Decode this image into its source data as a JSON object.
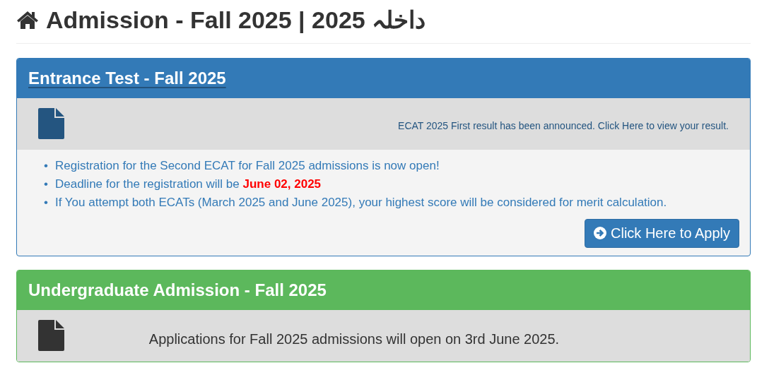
{
  "page": {
    "title": "Admission - Fall 2025 | 2025 داخلہ"
  },
  "panels": [
    {
      "kind": "primary",
      "heading": "Entrance Test - Fall 2025",
      "heading_link": true,
      "notice": "ECAT 2025 First result has been announced. Click Here to view your result.",
      "bullets": [
        {
          "marker": "•",
          "text": "Registration for the Second ECAT for Fall 2025 admissions is now open!"
        },
        {
          "marker": "•",
          "text": "Deadline for the registration will be",
          "highlight": "June 02, 2025"
        },
        {
          "marker": "•",
          "text": "If You attempt both ECATs (March 2025 and June 2025), your highest score will be considered for merit calculation."
        }
      ],
      "button": "Click Here to Apply"
    },
    {
      "kind": "success",
      "heading": "Undergraduate Admission - Fall 2025",
      "heading_link": false,
      "notice": "Applications for Fall 2025 admissions will open on 3rd June 2025."
    }
  ]
}
